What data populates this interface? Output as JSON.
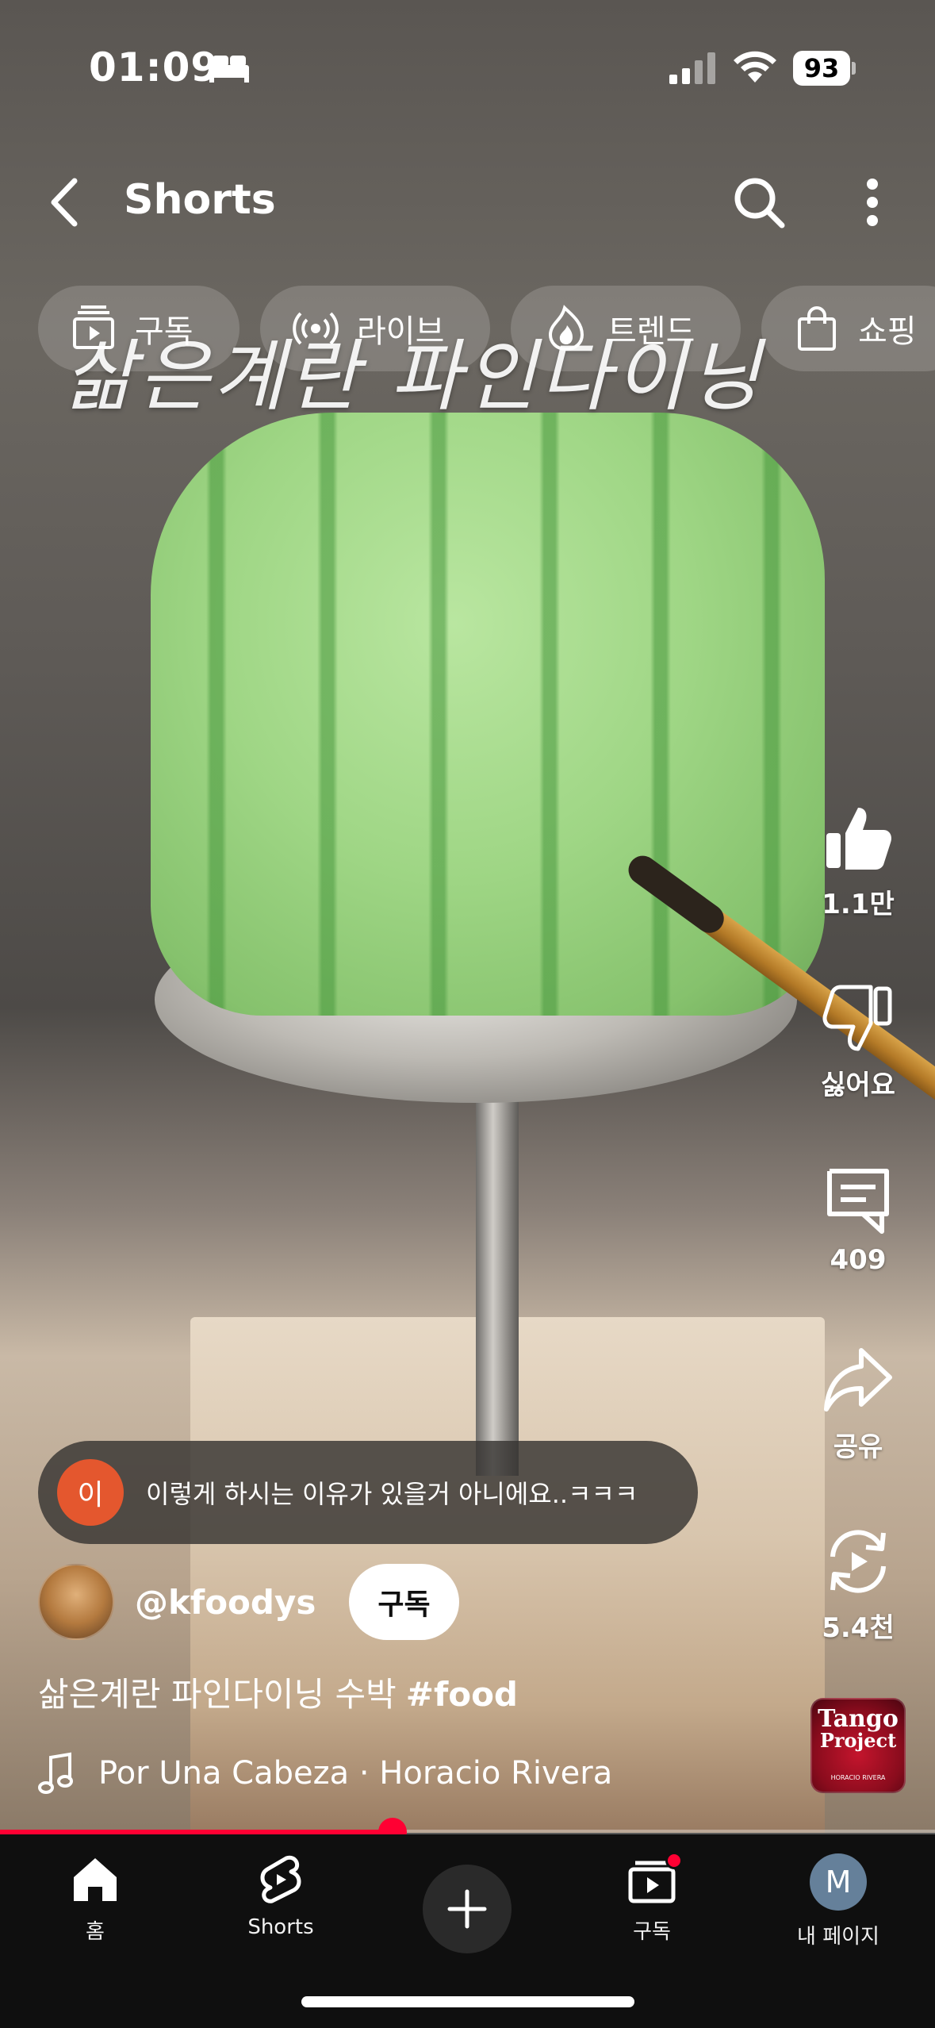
{
  "status_bar": {
    "time": "01:09",
    "battery": "93"
  },
  "header": {
    "title": "Shorts"
  },
  "chips": [
    {
      "label": "구독",
      "icon": "subscriptions-icon"
    },
    {
      "label": "라이브",
      "icon": "live-icon"
    },
    {
      "label": "트렌드",
      "icon": "trending-icon"
    },
    {
      "label": "쇼핑",
      "icon": "shopping-bag-icon"
    }
  ],
  "video": {
    "overlay_caption": "삶은계란 파인다이닝",
    "progress_percent": 42
  },
  "actions": {
    "like_count": "1.1만",
    "dislike_label": "싫어요",
    "comment_count": "409",
    "share_label": "공유",
    "remix_count": "5.4천"
  },
  "comment": {
    "avatar_letter": "이",
    "text": "이렇게 하시는 이유가 있을거 아니에요..ㅋㅋㅋ"
  },
  "channel": {
    "handle": "@kfoodys",
    "subscribe_label": "구독"
  },
  "title": {
    "text": "삶은계란 파인다이닝 수박",
    "hashtag": "#food"
  },
  "music": {
    "track": "Por Una Cabeza · Horacio Rivera",
    "thumb_line1": "Tango",
    "thumb_line2": "Project",
    "thumb_line3": "HORACIO RIVERA"
  },
  "bottom_nav": {
    "home": "홈",
    "shorts": "Shorts",
    "subscriptions": "구독",
    "profile": "내 페이지",
    "profile_initial": "M"
  },
  "colors": {
    "accent": "#ff0033",
    "nav_background": "#0f0f0f",
    "comment_avatar": "#e4572e"
  }
}
